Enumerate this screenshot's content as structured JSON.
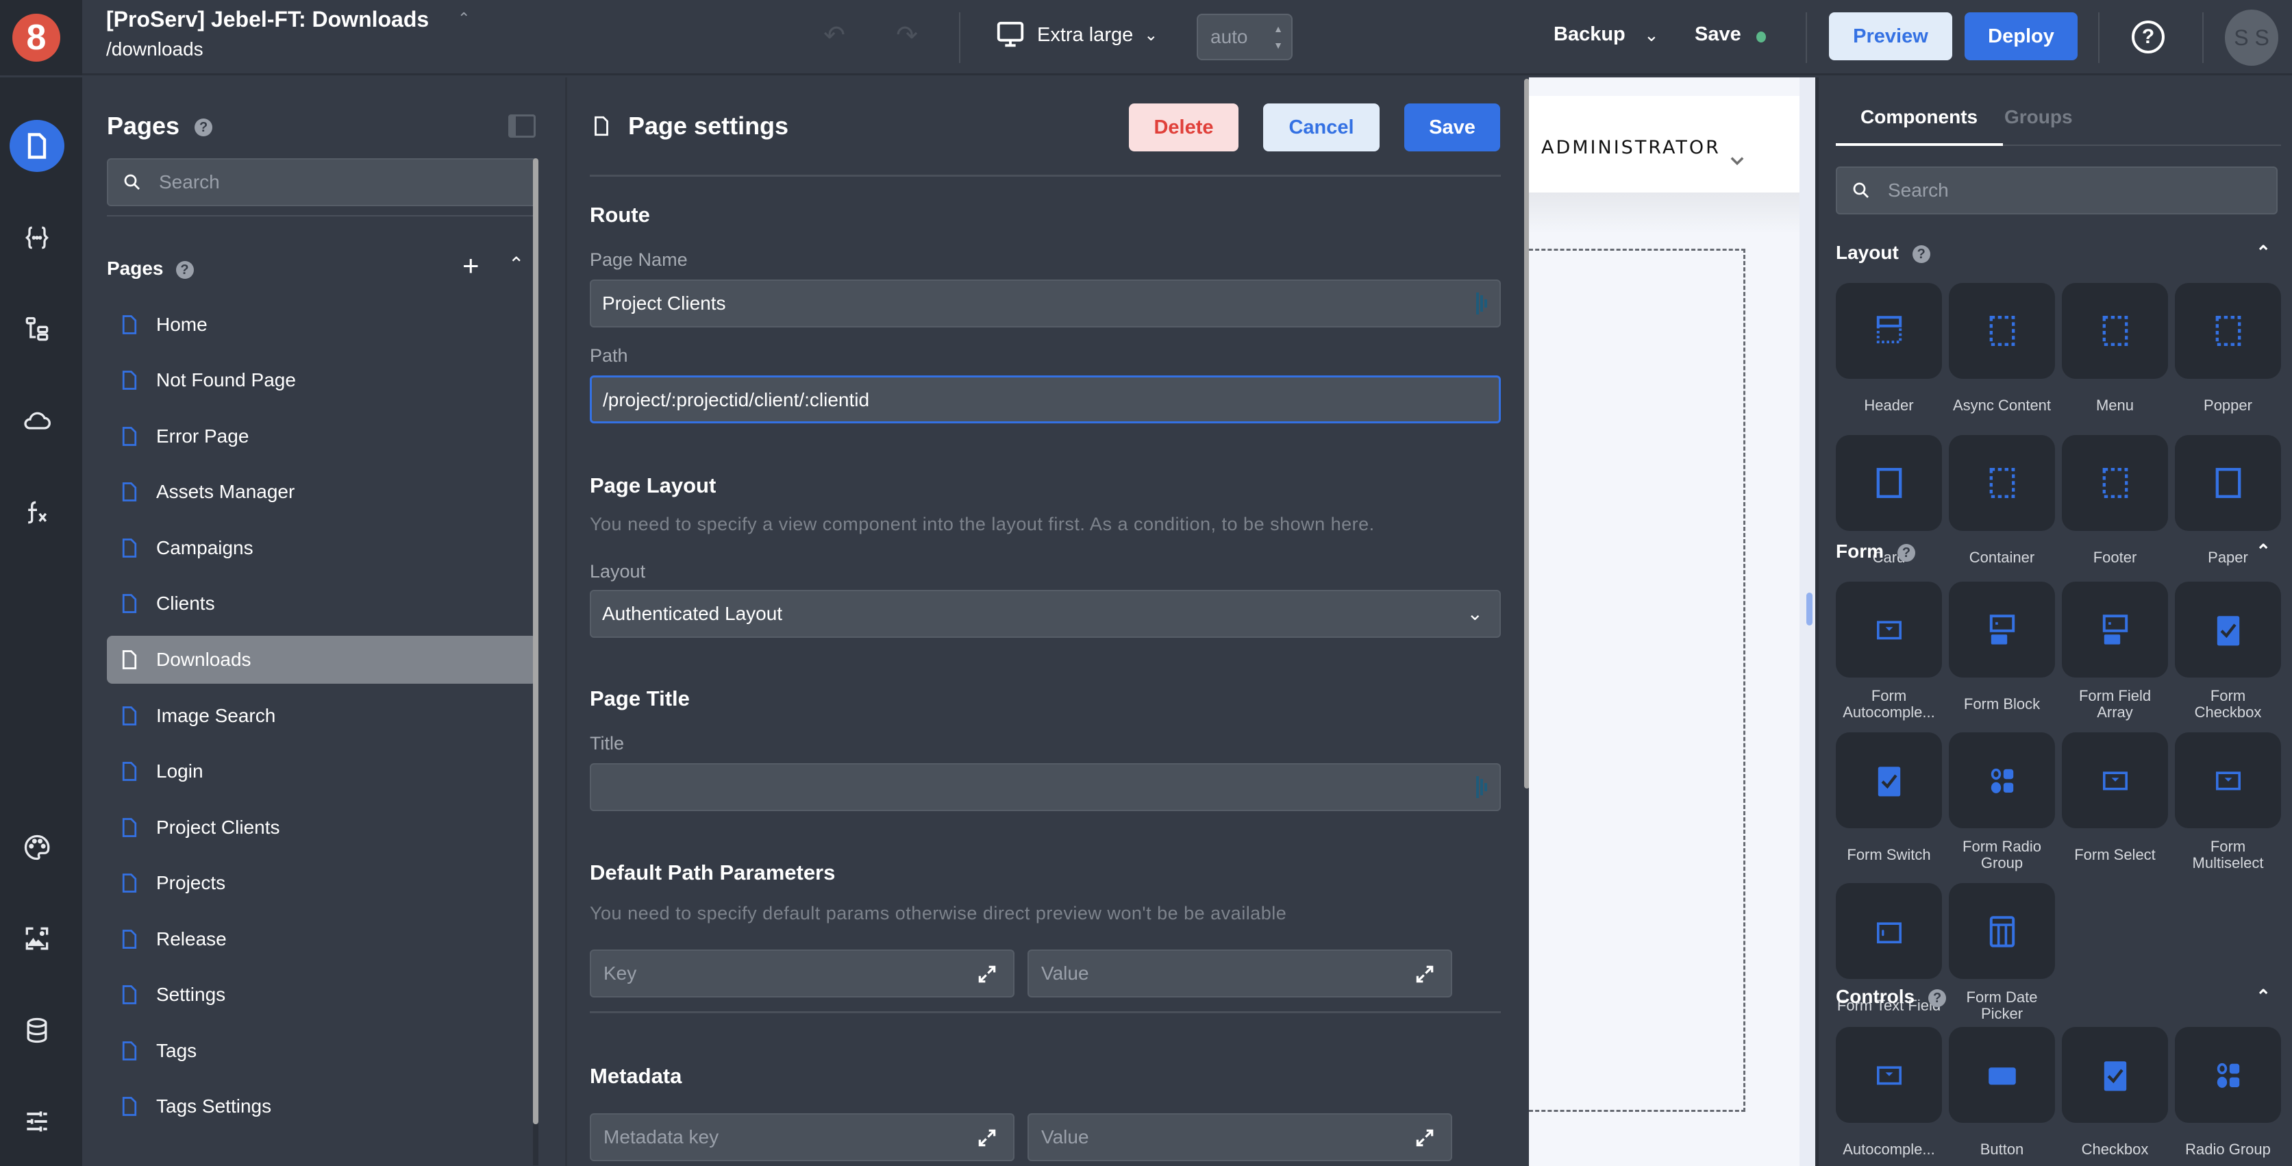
{
  "app": {
    "title": "[ProServ] Jebel-FT: Downloads",
    "route": "/downloads",
    "logo_text": "8"
  },
  "toolbar": {
    "device_label": "Extra large",
    "zoom_value": "auto",
    "backup_label": "Backup",
    "save_label": "Save",
    "save_status_color": "#5cb88a",
    "preview_label": "Preview",
    "deploy_label": "Deploy",
    "help_glyph": "?",
    "avatar_initials": "S S"
  },
  "rail": {
    "items": [
      {
        "name": "pages-icon",
        "active": true
      },
      {
        "name": "code-braces-icon"
      },
      {
        "name": "tree-structure-icon"
      },
      {
        "name": "cloud-icon"
      },
      {
        "name": "function-icon"
      },
      {
        "name": "palette-icon"
      },
      {
        "name": "image-assets-icon"
      },
      {
        "name": "database-icon"
      },
      {
        "name": "settings-sliders-icon"
      }
    ]
  },
  "pages_panel": {
    "title": "Pages",
    "search_placeholder": "Search",
    "subheader": "Pages",
    "pages": [
      {
        "label": "Home"
      },
      {
        "label": "Not Found Page"
      },
      {
        "label": "Error Page"
      },
      {
        "label": "Assets Manager"
      },
      {
        "label": "Campaigns"
      },
      {
        "label": "Clients"
      },
      {
        "label": "Downloads",
        "active": true
      },
      {
        "label": "Image Search"
      },
      {
        "label": "Login"
      },
      {
        "label": "Project Clients"
      },
      {
        "label": "Projects"
      },
      {
        "label": "Release"
      },
      {
        "label": "Settings"
      },
      {
        "label": "Tags"
      },
      {
        "label": "Tags Settings"
      }
    ]
  },
  "page_settings": {
    "title": "Page settings",
    "delete_label": "Delete",
    "cancel_label": "Cancel",
    "save_label": "Save",
    "route": {
      "title": "Route",
      "page_name_label": "Page Name",
      "page_name_value": "Project Clients",
      "path_label": "Path",
      "path_value": "/project/:projectid/client/:clientid"
    },
    "layout": {
      "title": "Page Layout",
      "hint": "You need to specify a view component into the layout first. As a condition, to be shown here.",
      "layout_label": "Layout",
      "layout_value": "Authenticated Layout"
    },
    "page_title": {
      "title": "Page Title",
      "title_label": "Title",
      "title_value": ""
    },
    "default_params": {
      "title": "Default Path Parameters",
      "hint": "You need to specify default params otherwise direct preview won't be be available",
      "key_placeholder": "Key",
      "value_placeholder": "Value"
    },
    "metadata": {
      "title": "Metadata",
      "key_placeholder": "Metadata key",
      "value_placeholder": "Value"
    }
  },
  "canvas": {
    "header_text": "ADMINISTRATOR"
  },
  "components_panel": {
    "tabs": [
      {
        "label": "Components",
        "active": true
      },
      {
        "label": "Groups"
      }
    ],
    "search_placeholder": "Search",
    "categories": [
      {
        "title": "Layout",
        "items": [
          {
            "label": "Header",
            "icon": "header-icon"
          },
          {
            "label": "Async Content",
            "icon": "dashed-box-icon"
          },
          {
            "label": "Menu",
            "icon": "dashed-box-icon"
          },
          {
            "label": "Popper",
            "icon": "dashed-box-icon"
          },
          {
            "label": "Card",
            "icon": "solid-box-icon"
          },
          {
            "label": "Container",
            "icon": "dashed-box-icon"
          },
          {
            "label": "Footer",
            "icon": "dashed-box-icon"
          },
          {
            "label": "Paper",
            "icon": "solid-box-icon"
          }
        ]
      },
      {
        "title": "Form",
        "items": [
          {
            "label": "Form Autocomple...",
            "icon": "select-icon"
          },
          {
            "label": "Form Block",
            "icon": "form-block-icon"
          },
          {
            "label": "Form Field Array",
            "icon": "form-block-icon"
          },
          {
            "label": "Form Checkbox",
            "icon": "checkbox-icon"
          },
          {
            "label": "Form Switch",
            "icon": "checkbox-icon"
          },
          {
            "label": "Form Radio Group",
            "icon": "radio-group-icon"
          },
          {
            "label": "Form Select",
            "icon": "select-icon"
          },
          {
            "label": "Form Multiselect",
            "icon": "select-icon"
          },
          {
            "label": "Form Text Field",
            "icon": "text-field-icon"
          },
          {
            "label": "Form Date Picker",
            "icon": "date-picker-icon"
          }
        ]
      },
      {
        "title": "Controls",
        "items": [
          {
            "label": "Autocomple...",
            "icon": "select-icon"
          },
          {
            "label": "Button",
            "icon": "button-icon"
          },
          {
            "label": "Checkbox",
            "icon": "checkbox-icon"
          },
          {
            "label": "Radio Group",
            "icon": "radio-group-icon"
          }
        ]
      }
    ]
  },
  "colors": {
    "accent": "#3471e3",
    "danger": "#e0403a",
    "panel_bg": "#353b46",
    "rail_bg": "#262b33",
    "logo": "#dc5343"
  }
}
